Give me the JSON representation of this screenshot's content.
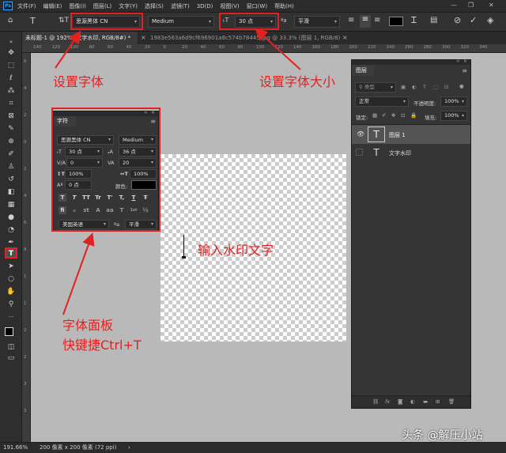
{
  "menubar": {
    "app_icon": "Ps",
    "items": [
      "文件(F)",
      "编辑(E)",
      "图像(I)",
      "图层(L)",
      "文字(Y)",
      "选择(S)",
      "滤镜(T)",
      "3D(D)",
      "视图(V)",
      "窗口(W)",
      "帮助(H)"
    ],
    "window_controls": [
      "—",
      "❐",
      "✕"
    ]
  },
  "options_bar": {
    "font_family": "思源黑体 CN",
    "font_style": "Medium",
    "font_size": "30 点",
    "antialias": "平滑",
    "text_color": "#000000"
  },
  "tabs": [
    {
      "label": "未标题-1 @ 192% (文字水印, RGB/8#) *",
      "close": "×"
    },
    {
      "label": "1983e563a6d9cf696901a8c574b78445.jpg @ 33.3% (图层 1, RGB/8) *",
      "close": "×"
    }
  ],
  "ruler": {
    "h_ticks": [
      "140",
      "120",
      "100",
      "80",
      "60",
      "40",
      "20",
      "0",
      "20",
      "40",
      "60",
      "80",
      "100",
      "120",
      "140",
      "160",
      "180",
      "200",
      "220",
      "240",
      "260",
      "280",
      "300",
      "320",
      "340"
    ],
    "v_ticks": [
      "6",
      "4",
      "2",
      "0",
      "2",
      "4",
      "6",
      "8",
      "1",
      "1",
      "2",
      "2",
      "3",
      "3"
    ]
  },
  "character_panel": {
    "title": "字符",
    "font_family": "思源黑体 CN",
    "font_style": "Medium",
    "font_size": "30 点",
    "leading": "36 点",
    "kerning": "0",
    "tracking": "20",
    "vertical_scale": "100%",
    "horizontal_scale": "100%",
    "baseline_shift": "0 点",
    "color_label": "颜色:",
    "language": "美国英语",
    "antialias_prefix": "ªa",
    "antialias": "平滑",
    "style_buttons": [
      "T",
      "T",
      "TT",
      "Tr",
      "T'",
      "T,",
      "T",
      "Ŧ"
    ],
    "opentype_buttons": [
      "fi",
      "ℴ",
      "st",
      "A",
      "aa",
      "T",
      "1st",
      "½"
    ]
  },
  "layers_panel": {
    "title": "图层",
    "search_placeholder": "类型",
    "blend_mode": "正常",
    "opacity_label": "不透明度:",
    "opacity": "100%",
    "lock_label": "锁定:",
    "fill_label": "填充:",
    "fill": "100%",
    "layers": [
      {
        "name": "图层 1",
        "type_icon": "T",
        "selected": true,
        "visible": true
      },
      {
        "name": "文字水印",
        "type_icon": "T",
        "selected": false,
        "visible": false
      }
    ],
    "footer_icons": [
      "⛓",
      "fx",
      "◙",
      "◐",
      "▬",
      "⊞",
      "🗑"
    ]
  },
  "statusbar": {
    "zoom": "191.66%",
    "doc_info": "200 像素 x 200 像素 (72 ppi)",
    "arrow": "›"
  },
  "annotations": {
    "set_font": "设置字体",
    "set_font_size": "设置字体大小",
    "enter_watermark": "输入水印文字",
    "font_panel": "字体面板",
    "shortcut": "快键捷Ctrl+T"
  },
  "watermark": {
    "text": "头条 @解压小站"
  },
  "colors": {
    "annotation_red": "#e22121",
    "canvas_gray": "#b9b9b9",
    "panel": "#353535"
  }
}
